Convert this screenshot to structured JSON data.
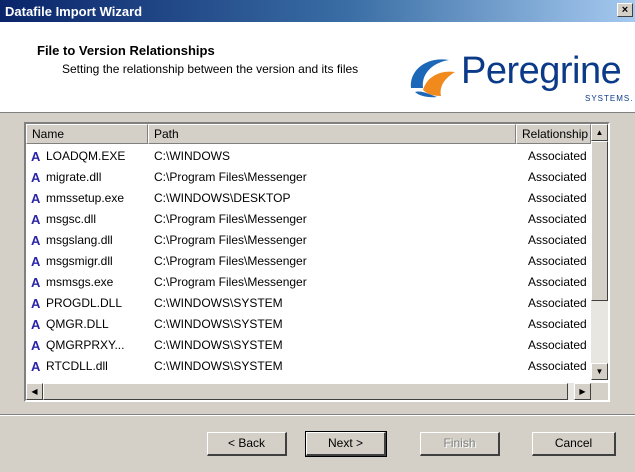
{
  "window": {
    "title": "Datafile Import Wizard",
    "close_glyph": "×"
  },
  "header": {
    "title": "File to Version Relationships",
    "subtitle": "Setting the relationship between the version and its files",
    "logo": {
      "name": "Peregrine",
      "sub": "SYSTEMS.",
      "colors": [
        "#1d67b8",
        "#f08a1c",
        "#0b3a88"
      ]
    }
  },
  "list": {
    "columns": [
      "Name",
      "Path",
      "Relationship"
    ],
    "row_icon": "A",
    "rows": [
      {
        "name": "LOADQM.EXE",
        "path": "C:\\WINDOWS",
        "relationship": "Associated"
      },
      {
        "name": "migrate.dll",
        "path": "C:\\Program Files\\Messenger",
        "relationship": "Associated"
      },
      {
        "name": "mmssetup.exe",
        "path": "C:\\WINDOWS\\DESKTOP",
        "relationship": "Associated"
      },
      {
        "name": "msgsc.dll",
        "path": "C:\\Program Files\\Messenger",
        "relationship": "Associated"
      },
      {
        "name": "msgslang.dll",
        "path": "C:\\Program Files\\Messenger",
        "relationship": "Associated"
      },
      {
        "name": "msgsmigr.dll",
        "path": "C:\\Program Files\\Messenger",
        "relationship": "Associated"
      },
      {
        "name": "msmsgs.exe",
        "path": "C:\\Program Files\\Messenger",
        "relationship": "Associated"
      },
      {
        "name": "PROGDL.DLL",
        "path": "C:\\WINDOWS\\SYSTEM",
        "relationship": "Associated"
      },
      {
        "name": "QMGR.DLL",
        "path": "C:\\WINDOWS\\SYSTEM",
        "relationship": "Associated"
      },
      {
        "name": "QMGRPRXY...",
        "path": "C:\\WINDOWS\\SYSTEM",
        "relationship": "Associated"
      },
      {
        "name": "RTCDLL.dll",
        "path": "C:\\WINDOWS\\SYSTEM",
        "relationship": "Associated"
      }
    ]
  },
  "buttons": {
    "back": "< Back",
    "next": "Next >",
    "finish": "Finish",
    "cancel": "Cancel"
  }
}
